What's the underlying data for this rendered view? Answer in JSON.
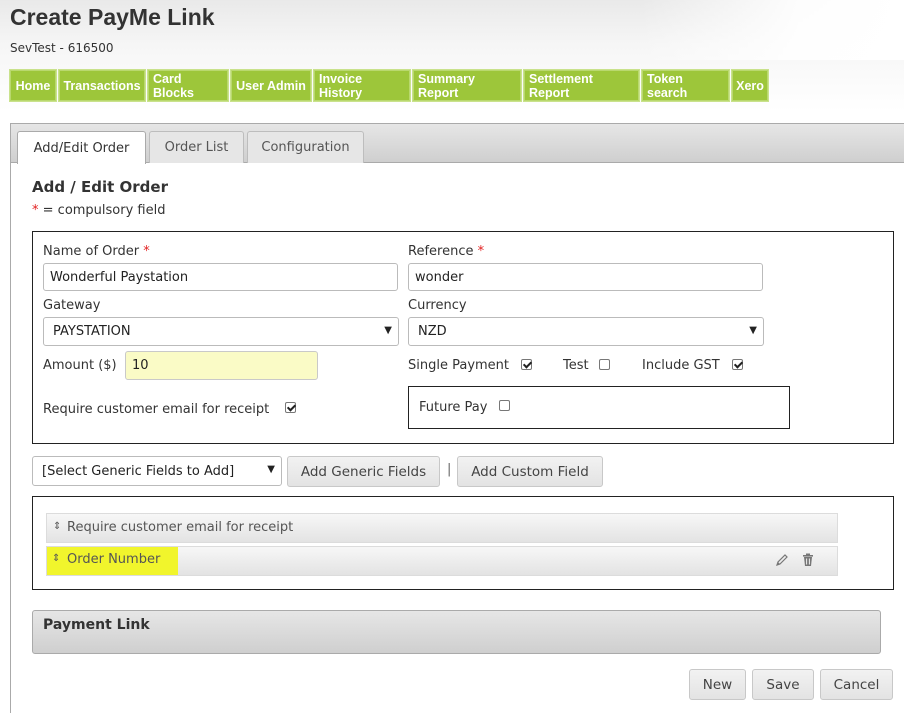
{
  "header": {
    "title": "Create PayMe Link",
    "subtitle": "SevTest - 616500"
  },
  "nav": {
    "items": [
      {
        "label": "Home"
      },
      {
        "label": "Transactions"
      },
      {
        "label": "Card Blocks"
      },
      {
        "label": "User Admin"
      },
      {
        "label": "Invoice History"
      },
      {
        "label": "Summary Report"
      },
      {
        "label": "Settlement Report"
      },
      {
        "label": "Token search"
      },
      {
        "label": "Xero"
      }
    ],
    "color": "#9dc63a"
  },
  "tabs": [
    {
      "label": "Add/Edit Order",
      "active": true
    },
    {
      "label": "Order List",
      "active": false
    },
    {
      "label": "Configuration",
      "active": false
    }
  ],
  "form": {
    "section_title": "Add / Edit Order",
    "required_marker": "*",
    "required_note": "= compulsory field",
    "name_label": "Name of Order",
    "name_value": "Wonderful Paystation",
    "reference_label": "Reference",
    "reference_value": "wonder",
    "gateway_label": "Gateway",
    "gateway_value": "PAYSTATION",
    "currency_label": "Currency",
    "currency_value": "NZD",
    "amount_label": "Amount ($)",
    "amount_value": "10",
    "single_payment_label": "Single Payment",
    "single_payment_checked": true,
    "test_label": "Test",
    "test_checked": false,
    "include_gst_label": "Include GST",
    "include_gst_checked": true,
    "require_email_label": "Require customer email for receipt",
    "require_email_checked": true,
    "future_pay_label": "Future Pay",
    "future_pay_checked": false
  },
  "fields_toolbar": {
    "select_value": "[Select Generic Fields to Add]",
    "add_generic_label": "Add Generic Fields",
    "separator": "|",
    "add_custom_label": "Add Custom Field"
  },
  "fields": [
    {
      "label": "Require customer email for receipt",
      "highlighted": false
    },
    {
      "label": "Order Number",
      "highlighted": true
    }
  ],
  "payment_link": {
    "title": "Payment Link"
  },
  "actions": {
    "new_label": "New",
    "save_label": "Save",
    "cancel_label": "Cancel"
  }
}
